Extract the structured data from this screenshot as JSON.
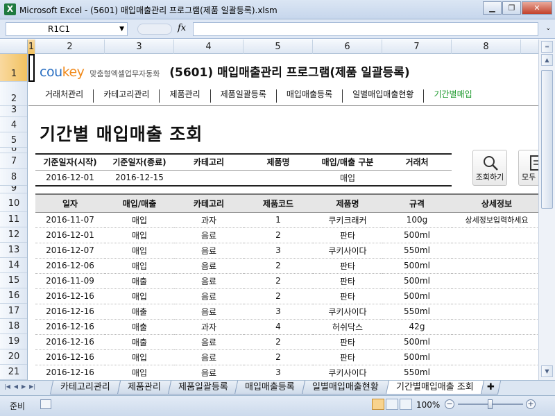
{
  "window": {
    "title": "Microsoft Excel - (5601) 매입매출관리 프로그램(제품 일괄등록).xlsm",
    "minimize": "▁",
    "restore": "❐",
    "close": "✕"
  },
  "formula_bar": {
    "name_box": "R1C1",
    "fx": "fx",
    "value": ""
  },
  "columns": [
    "1",
    "2",
    "3",
    "4",
    "5",
    "6",
    "7",
    "8"
  ],
  "rows": [
    "1",
    "2",
    "3",
    "4",
    "5",
    "6",
    "7",
    "8",
    "9",
    "10",
    "11",
    "12",
    "13",
    "14",
    "15",
    "16",
    "17",
    "18",
    "19",
    "20",
    "21"
  ],
  "brand": {
    "logo_a": "cou",
    "logo_b": "key",
    "tagline": "맞춤형엑셀업무자동화",
    "program": "(5601) 매입매출관리 프로그램(제품 일괄등록)"
  },
  "nav": [
    "거래처관리",
    "카테고리관리",
    "제품관리",
    "제품일괄등록",
    "매입매출등록",
    "일별매입매출현황",
    "기간별매입"
  ],
  "page_title": "기간별 매입매출 조회",
  "filter": {
    "headers": [
      "기준일자(시작)",
      "기준일자(종료)",
      "카테고리",
      "제품명",
      "매입/매출 구분",
      "거래처"
    ],
    "values": [
      "2016-12-01",
      "2016-12-15",
      "",
      "",
      "매입",
      ""
    ]
  },
  "buttons": {
    "search_label": "조회하기",
    "all_label": "모두"
  },
  "table": {
    "headers": [
      "일자",
      "매입/매출",
      "카테고리",
      "제품코드",
      "제품명",
      "규격",
      "상세정보"
    ],
    "rows": [
      [
        "2016-11-07",
        "매입",
        "과자",
        "1",
        "쿠키크래커",
        "100g",
        "상세정보입력하세요"
      ],
      [
        "2016-12-01",
        "매입",
        "음료",
        "2",
        "판타",
        "500ml",
        ""
      ],
      [
        "2016-12-07",
        "매입",
        "음료",
        "3",
        "쿠키사이다",
        "550ml",
        ""
      ],
      [
        "2016-12-06",
        "매입",
        "음료",
        "2",
        "판타",
        "500ml",
        ""
      ],
      [
        "2016-11-09",
        "매출",
        "음료",
        "2",
        "판타",
        "500ml",
        ""
      ],
      [
        "2016-12-16",
        "매입",
        "음료",
        "2",
        "판타",
        "500ml",
        ""
      ],
      [
        "2016-12-16",
        "매출",
        "음료",
        "3",
        "쿠키사이다",
        "550ml",
        ""
      ],
      [
        "2016-12-16",
        "매출",
        "과자",
        "4",
        "허쉬닥스",
        "42g",
        ""
      ],
      [
        "2016-12-16",
        "매출",
        "음료",
        "2",
        "판타",
        "500ml",
        ""
      ],
      [
        "2016-12-16",
        "매입",
        "음료",
        "2",
        "판타",
        "500ml",
        ""
      ],
      [
        "2016-12-16",
        "매입",
        "음료",
        "3",
        "쿠키사이다",
        "550ml",
        ""
      ]
    ]
  },
  "sheet_tabs": [
    "카테고리관리",
    "제품관리",
    "제품일괄등록",
    "매입매출등록",
    "일별매입매출현황",
    "기간별매입매출 조회"
  ],
  "active_tab_index": 5,
  "status": {
    "ready": "준비",
    "zoom": "100%",
    "zoom_minus": "−",
    "zoom_plus": "+"
  },
  "colors": {
    "accent_green": "#1e9a2e",
    "brand_blue": "#2a6fc2",
    "brand_orange": "#f08a1c"
  }
}
